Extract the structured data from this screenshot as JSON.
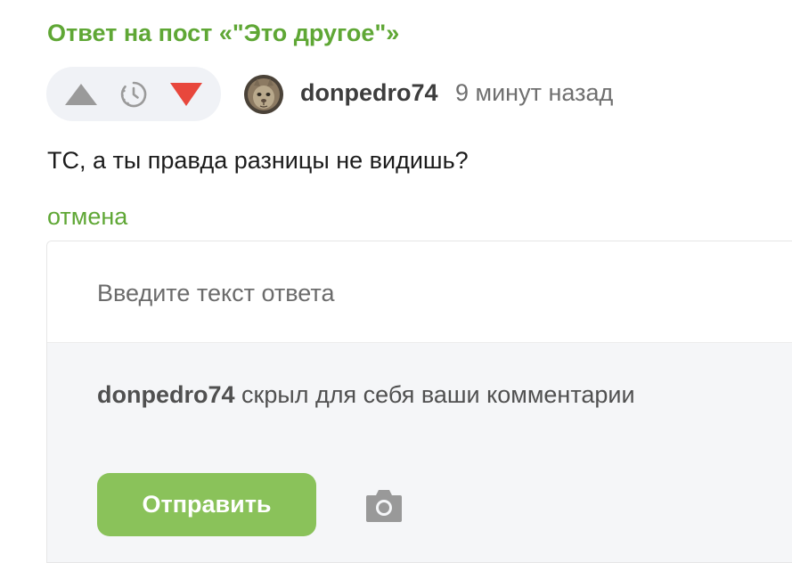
{
  "reply_header": {
    "title": "Ответ на пост «\"Это другое\"»"
  },
  "comment": {
    "author": "donpedro74",
    "time": "9 минут назад",
    "text": "ТС, а ты правда разницы не видишь?",
    "avatar_icon": "avatar-image",
    "vote_icons": [
      "upvote-icon",
      "timer-icon",
      "downvote-icon"
    ]
  },
  "actions": {
    "cancel_label": "отмена"
  },
  "reply_form": {
    "placeholder": "Введите текст ответа",
    "notice_user": "donpedro74",
    "notice_text": " скрыл для себя ваши комментарии",
    "send_label": "Отправить",
    "attach_icon": "camera-icon"
  },
  "colors": {
    "accent_green": "#5fa735",
    "button_green": "#8ac25a",
    "downvote_red": "#e8473c",
    "icon_gray": "#9a9a9a"
  }
}
